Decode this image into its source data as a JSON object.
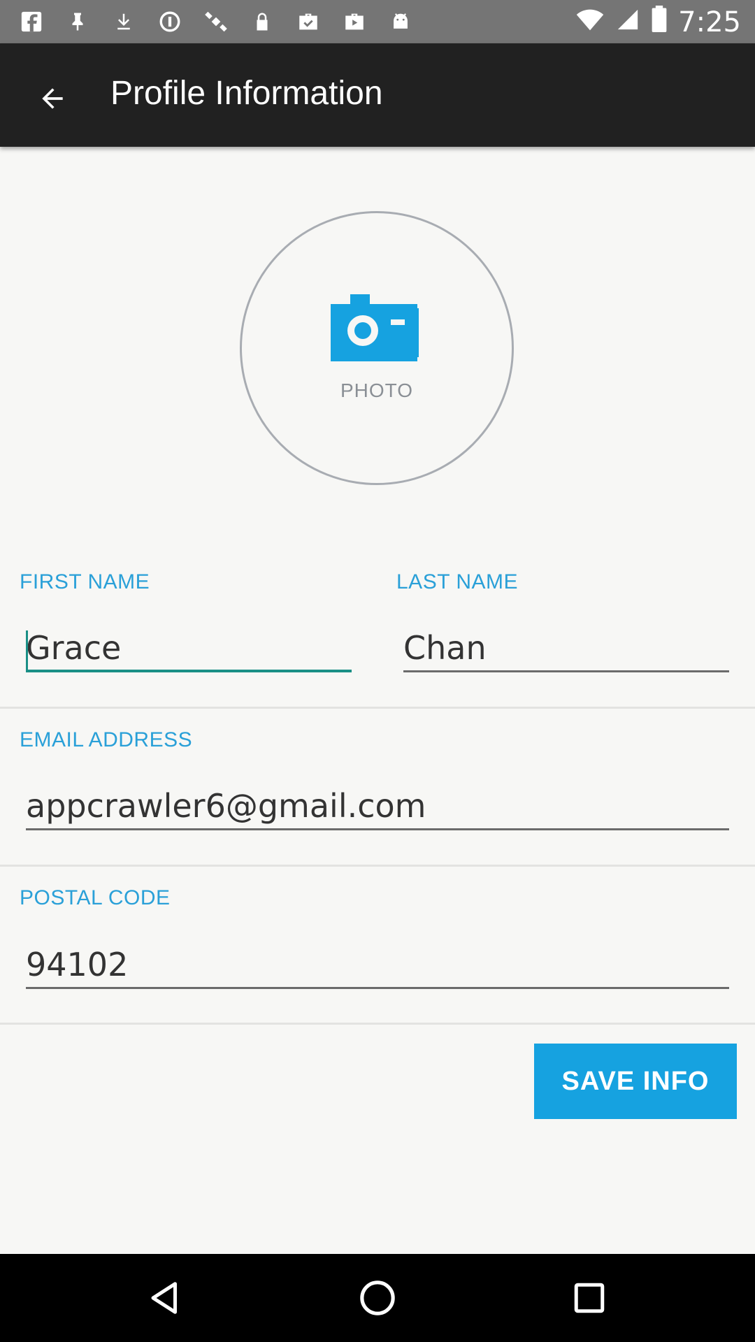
{
  "status_bar": {
    "time": "7:25",
    "icons": [
      "fb-icon",
      "pin-icon",
      "download-icon",
      "circle-icon",
      "satellite-icon",
      "lock-icon",
      "briefcase-check-icon",
      "briefcase-play-icon",
      "android-icon"
    ]
  },
  "app_bar": {
    "title": "Profile Information"
  },
  "photo": {
    "label": "PHOTO"
  },
  "form": {
    "first_name_label": "FIRST NAME",
    "first_name_value": "Grace",
    "last_name_label": "LAST NAME",
    "last_name_value": "Chan",
    "email_label": "EMAIL ADDRESS",
    "email_value": "appcrawler6@gmail.com",
    "postal_label": "POSTAL CODE",
    "postal_value": "94102"
  },
  "actions": {
    "save_label": "SAVE INFO"
  },
  "colors": {
    "accent": "#16a2e0",
    "label": "#2aa0d8",
    "active_field": "#1a8f86",
    "app_bar": "#212121"
  }
}
